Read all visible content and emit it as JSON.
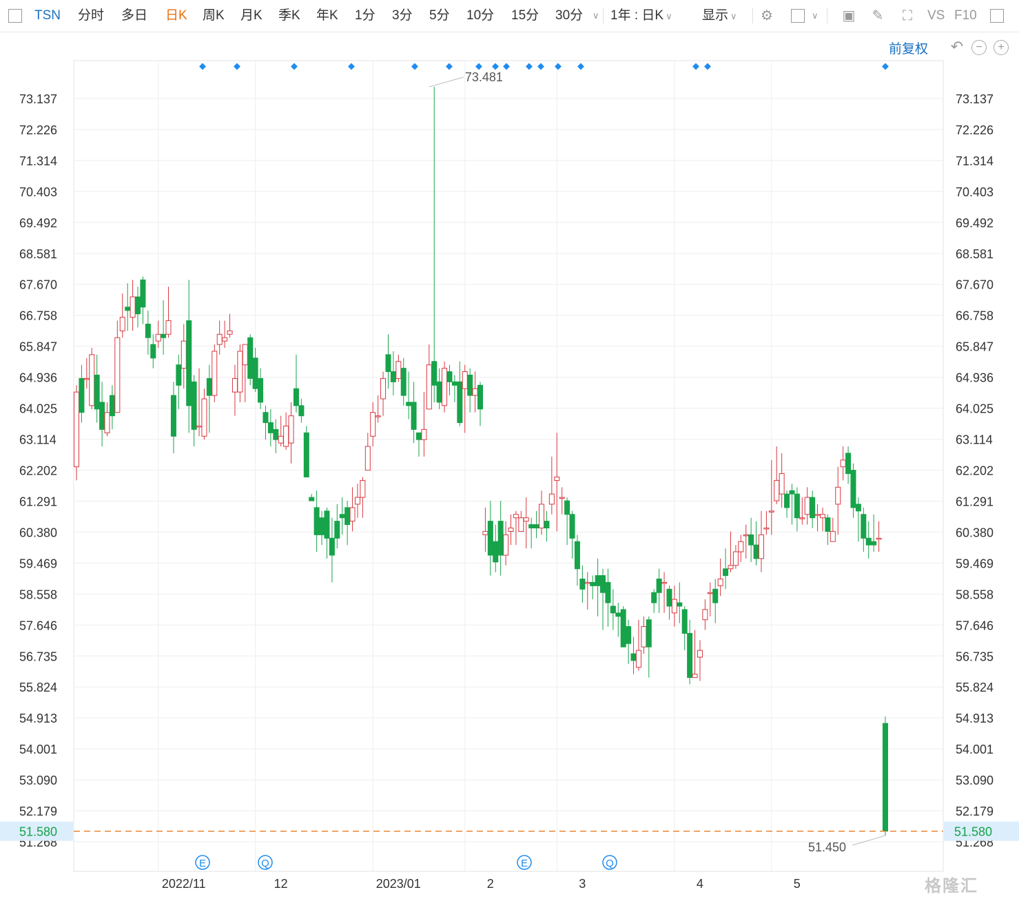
{
  "toolbar": {
    "symbol": "TSN",
    "periods": [
      "分时",
      "多日",
      "日K",
      "周K",
      "月K",
      "季K",
      "年K",
      "1分",
      "3分",
      "5分",
      "10分",
      "15分",
      "30分"
    ],
    "active_period": "日K",
    "range_select": "1年 : 日K",
    "display_label": "显示",
    "vs_label": "VS",
    "f10_label": "F10"
  },
  "header": {
    "adjust_label": "前复权"
  },
  "colors": {
    "up": "#d9363e",
    "down": "#17a34a",
    "last_price_line": "#e8700b",
    "last_price_bg": "#dceefb",
    "marker": "#1f8cf0",
    "grid": "#eeeeee"
  },
  "watermark": "格隆汇",
  "chart_data": {
    "type": "candlestick",
    "ylim": [
      51.268,
      74.2
    ],
    "y_ticks": [
      73.137,
      72.226,
      71.314,
      70.403,
      69.492,
      68.581,
      67.67,
      66.758,
      65.847,
      64.936,
      64.025,
      63.114,
      62.202,
      61.291,
      60.38,
      59.469,
      58.558,
      57.646,
      56.735,
      55.824,
      54.913,
      54.001,
      53.09,
      52.179,
      51.268
    ],
    "y_tick_labels": [
      "73.137",
      "72.226",
      "71.314",
      "70.403",
      "69.492",
      "68.581",
      "67.670",
      "66.758",
      "65.847",
      "64.936",
      "64.025",
      "63.114",
      "62.202",
      "61.291",
      "60.380",
      "59.469",
      "58.558",
      "57.646",
      "56.735",
      "55.824",
      "54.913",
      "54.001",
      "53.090",
      "52.179",
      "51.268"
    ],
    "x_ticks": [
      {
        "label": "2022/11",
        "index": 16
      },
      {
        "label": "12",
        "index": 35
      },
      {
        "label": "2023/01",
        "index": 58
      },
      {
        "label": "2",
        "index": 76
      },
      {
        "label": "3",
        "index": 94
      },
      {
        "label": "4",
        "index": 117
      },
      {
        "label": "5",
        "index": 136
      }
    ],
    "last_price": 51.58,
    "last_price_label": "51.580",
    "max_label": {
      "value": 73.481,
      "text": "73.481",
      "index": 69
    },
    "min_label": {
      "value": 51.45,
      "text": "51.450",
      "index": 140
    },
    "top_markers": [
      22,
      28,
      38,
      48,
      59,
      65,
      70,
      73,
      75,
      79,
      81,
      84,
      88,
      107,
      109,
      140
    ],
    "event_markers": [
      {
        "label": "E",
        "index": 22
      },
      {
        "label": "Q",
        "index": 34
      },
      {
        "label": "E",
        "index": 77
      },
      {
        "label": "Q",
        "index": 92
      }
    ],
    "candles": [
      [
        62.3,
        64.5,
        64.7,
        61.9
      ],
      [
        64.9,
        63.9,
        65.3,
        63.6
      ],
      [
        64.9,
        64.9,
        65.5,
        64.6
      ],
      [
        64.1,
        65.6,
        65.8,
        64.0
      ],
      [
        65.0,
        64.0,
        65.6,
        63.6
      ],
      [
        64.2,
        63.4,
        64.8,
        62.9
      ],
      [
        63.3,
        63.9,
        64.2,
        63.2
      ],
      [
        64.4,
        63.8,
        64.7,
        63.4
      ],
      [
        63.9,
        66.1,
        66.6,
        64.0
      ],
      [
        66.3,
        66.7,
        67.4,
        66.1
      ],
      [
        67.0,
        66.9,
        67.7,
        66.3
      ],
      [
        66.7,
        67.3,
        67.8,
        66.3
      ],
      [
        67.3,
        66.8,
        67.6,
        66.4
      ],
      [
        67.8,
        67.0,
        67.9,
        66.5
      ],
      [
        66.5,
        66.1,
        66.9,
        65.6
      ],
      [
        65.9,
        65.5,
        66.2,
        65.2
      ],
      [
        66.0,
        66.2,
        66.6,
        65.8
      ],
      [
        66.2,
        66.1,
        67.2,
        65.6
      ],
      [
        66.2,
        66.6,
        67.6,
        66.1
      ],
      [
        64.4,
        63.2,
        64.8,
        62.7
      ],
      [
        65.3,
        64.7,
        65.6,
        64.0
      ],
      [
        65.2,
        66.0,
        66.5,
        64.6
      ],
      [
        66.6,
        64.1,
        67.8,
        63.3
      ],
      [
        64.8,
        63.4,
        65.0,
        62.9
      ],
      [
        63.5,
        63.5,
        65.2,
        63.2
      ],
      [
        63.2,
        64.3,
        64.6,
        63.1
      ],
      [
        64.9,
        64.4,
        65.3,
        63.3
      ],
      [
        64.4,
        65.7,
        65.9,
        64.2
      ],
      [
        65.9,
        66.2,
        66.6,
        65.6
      ],
      [
        66.0,
        66.1,
        66.6,
        65.8
      ],
      [
        66.2,
        66.3,
        66.8,
        66.1
      ],
      [
        64.5,
        64.9,
        65.3,
        63.8
      ],
      [
        64.5,
        65.7,
        65.9,
        64.2
      ],
      [
        65.3,
        65.9,
        65.9,
        64.2
      ],
      [
        66.1,
        64.9,
        66.2,
        64.7
      ],
      [
        65.5,
        64.6,
        65.8,
        64.5
      ],
      [
        64.9,
        64.2,
        65.2,
        64.0
      ],
      [
        63.9,
        63.6,
        64.1,
        63.1
      ],
      [
        63.6,
        63.3,
        64.0,
        62.9
      ],
      [
        63.4,
        63.1,
        63.7,
        62.7
      ],
      [
        63.0,
        63.2,
        63.8,
        62.9
      ],
      [
        62.9,
        63.5,
        63.9,
        62.8
      ],
      [
        63.0,
        63.8,
        64.2,
        62.4
      ],
      [
        64.6,
        64.1,
        65.6,
        63.9
      ],
      [
        64.1,
        63.8,
        64.3,
        63.6
      ],
      [
        63.3,
        62.0,
        63.5,
        62.3
      ],
      [
        61.4,
        61.3,
        61.5,
        61.3
      ],
      [
        61.1,
        60.3,
        61.6,
        59.8
      ],
      [
        60.8,
        60.3,
        61.0,
        60.0
      ],
      [
        61.0,
        60.2,
        61.1,
        59.6
      ],
      [
        60.2,
        59.7,
        60.8,
        58.9
      ],
      [
        60.7,
        60.2,
        61.2,
        59.9
      ],
      [
        60.9,
        60.8,
        61.4,
        60.3
      ],
      [
        61.1,
        60.6,
        61.3,
        60.0
      ],
      [
        60.7,
        61.1,
        61.7,
        60.4
      ],
      [
        61.2,
        61.4,
        61.8,
        60.8
      ],
      [
        61.4,
        61.9,
        62.0,
        60.8
      ],
      [
        62.2,
        62.9,
        63.3,
        62.2
      ],
      [
        63.2,
        63.9,
        64.2,
        62.9
      ],
      [
        63.8,
        63.8,
        64.4,
        63.6
      ],
      [
        64.3,
        64.9,
        65.1,
        63.8
      ],
      [
        65.6,
        65.1,
        66.2,
        64.6
      ],
      [
        65.1,
        64.8,
        65.7,
        64.4
      ],
      [
        64.9,
        65.4,
        65.6,
        64.8
      ],
      [
        65.2,
        64.4,
        65.5,
        64.1
      ],
      [
        64.2,
        64.1,
        65.1,
        63.7
      ],
      [
        64.2,
        63.4,
        64.8,
        63.0
      ],
      [
        63.3,
        63.1,
        63.3,
        62.6
      ],
      [
        63.1,
        63.4,
        64.5,
        62.6
      ],
      [
        64.0,
        65.3,
        65.9,
        64.1
      ],
      [
        65.4,
        64.7,
        73.481,
        64.2
      ],
      [
        64.8,
        64.2,
        65.2,
        64.0
      ],
      [
        64.1,
        65.2,
        65.4,
        63.9
      ],
      [
        65.1,
        64.8,
        65.3,
        64.4
      ],
      [
        64.8,
        64.7,
        65.0,
        64.2
      ],
      [
        64.8,
        63.6,
        65.4,
        63.5
      ],
      [
        64.6,
        65.1,
        65.3,
        63.3
      ],
      [
        65.0,
        64.4,
        65.2,
        63.9
      ],
      [
        64.4,
        64.6,
        65.1,
        63.9
      ],
      [
        64.7,
        64.0,
        64.8,
        63.5
      ],
      [
        60.3,
        60.4,
        61.1,
        59.8
      ],
      [
        60.7,
        59.7,
        61.3,
        59.1
      ],
      [
        60.1,
        59.5,
        60.6,
        59.2
      ],
      [
        60.7,
        59.7,
        61.3,
        59.1
      ],
      [
        59.7,
        60.3,
        60.7,
        59.4
      ],
      [
        60.4,
        60.5,
        60.9,
        60.0
      ],
      [
        60.8,
        60.9,
        61.0,
        60.0
      ],
      [
        60.4,
        60.8,
        61.0,
        60.4
      ],
      [
        60.7,
        60.8,
        61.4,
        59.9
      ],
      [
        60.6,
        60.5,
        60.8,
        59.9
      ],
      [
        60.6,
        60.5,
        61.0,
        60.2
      ],
      [
        60.5,
        61.2,
        61.6,
        60.3
      ],
      [
        60.7,
        60.5,
        61.0,
        60.1
      ],
      [
        61.2,
        61.5,
        62.6,
        60.9
      ],
      [
        61.9,
        62.0,
        63.3,
        60.4
      ],
      [
        61.4,
        61.4,
        61.7,
        60.9
      ],
      [
        61.3,
        60.9,
        61.4,
        60.0
      ],
      [
        60.9,
        60.2,
        61.0,
        59.6
      ],
      [
        60.1,
        59.3,
        60.3,
        58.8
      ],
      [
        59.0,
        58.7,
        59.4,
        58.3
      ],
      [
        58.9,
        58.9,
        59.2,
        58.1
      ],
      [
        58.9,
        58.8,
        59.1,
        58.4
      ],
      [
        59.1,
        58.8,
        59.6,
        57.9
      ],
      [
        59.1,
        58.6,
        59.3,
        57.5
      ],
      [
        58.9,
        58.3,
        59.3,
        57.6
      ],
      [
        58.2,
        58.0,
        58.7,
        57.5
      ],
      [
        58.0,
        57.9,
        58.3,
        57.3
      ],
      [
        58.1,
        57.0,
        58.2,
        57.0
      ],
      [
        57.6,
        57.1,
        57.8,
        56.5
      ],
      [
        56.8,
        56.6,
        57.3,
        56.2
      ],
      [
        56.4,
        56.9,
        57.8,
        56.3
      ],
      [
        57.0,
        57.6,
        57.9,
        56.8
      ],
      [
        57.8,
        57.0,
        57.9,
        56.1
      ],
      [
        58.6,
        58.3,
        58.7,
        58.0
      ],
      [
        59.0,
        58.6,
        59.3,
        58.0
      ],
      [
        58.9,
        58.9,
        59.2,
        58.0
      ],
      [
        58.7,
        58.2,
        58.8,
        57.8
      ],
      [
        58.0,
        58.4,
        58.8,
        57.6
      ],
      [
        58.3,
        58.2,
        58.9,
        57.7
      ],
      [
        58.1,
        57.4,
        58.2,
        56.9
      ],
      [
        57.4,
        56.1,
        57.8,
        55.9
      ],
      [
        56.1,
        56.2,
        57.5,
        56.2
      ],
      [
        56.7,
        56.9,
        57.2,
        56.0
      ],
      [
        57.8,
        58.1,
        58.4,
        57.5
      ],
      [
        58.6,
        58.6,
        58.9,
        57.9
      ],
      [
        58.7,
        58.3,
        59.0,
        57.7
      ],
      [
        58.8,
        59.0,
        59.6,
        58.5
      ],
      [
        59.3,
        59.1,
        59.9,
        58.7
      ],
      [
        59.3,
        59.4,
        60.4,
        59.2
      ],
      [
        59.4,
        59.8,
        60.0,
        59.3
      ],
      [
        59.8,
        60.1,
        60.3,
        59.5
      ],
      [
        60.3,
        60.3,
        60.6,
        59.6
      ],
      [
        60.3,
        60.0,
        60.8,
        59.5
      ],
      [
        60.0,
        59.6,
        60.7,
        59.4
      ],
      [
        59.6,
        60.3,
        61.0,
        59.2
      ],
      [
        60.5,
        60.5,
        61.0,
        60.3
      ]
    ],
    "extra_candles_note": "",
    "tail_candles": [
      [
        61.0,
        61.0,
        62.5,
        60.3
      ],
      [
        61.3,
        61.9,
        62.9,
        61.2
      ],
      [
        61.5,
        62.1,
        62.7,
        61.1
      ],
      [
        61.5,
        61.1,
        61.6,
        60.8
      ],
      [
        61.6,
        61.5,
        61.8,
        60.6
      ],
      [
        61.5,
        60.8,
        61.7,
        60.4
      ],
      [
        60.8,
        60.8,
        61.4,
        60.6
      ],
      [
        60.9,
        61.4,
        61.7,
        60.6
      ],
      [
        61.4,
        60.8,
        61.6,
        60.5
      ],
      [
        60.9,
        60.9,
        61.2,
        60.4
      ],
      [
        60.8,
        60.9,
        61.1,
        60.4
      ],
      [
        60.8,
        60.4,
        60.9,
        60.0
      ],
      [
        60.1,
        60.4,
        60.8,
        60.1
      ],
      [
        61.2,
        61.7,
        62.3,
        60.3
      ],
      [
        62.3,
        62.5,
        62.9,
        61.9
      ],
      [
        62.7,
        62.1,
        62.9,
        61.8
      ],
      [
        62.2,
        61.1,
        62.4,
        60.8
      ],
      [
        61.2,
        61.0,
        61.4,
        60.1
      ],
      [
        60.9,
        60.2,
        61.1,
        59.8
      ],
      [
        60.2,
        60.0,
        60.7,
        59.6
      ],
      [
        60.1,
        60.0,
        60.9,
        59.8
      ],
      [
        60.2,
        60.2,
        60.7,
        59.8
      ]
    ]
  }
}
